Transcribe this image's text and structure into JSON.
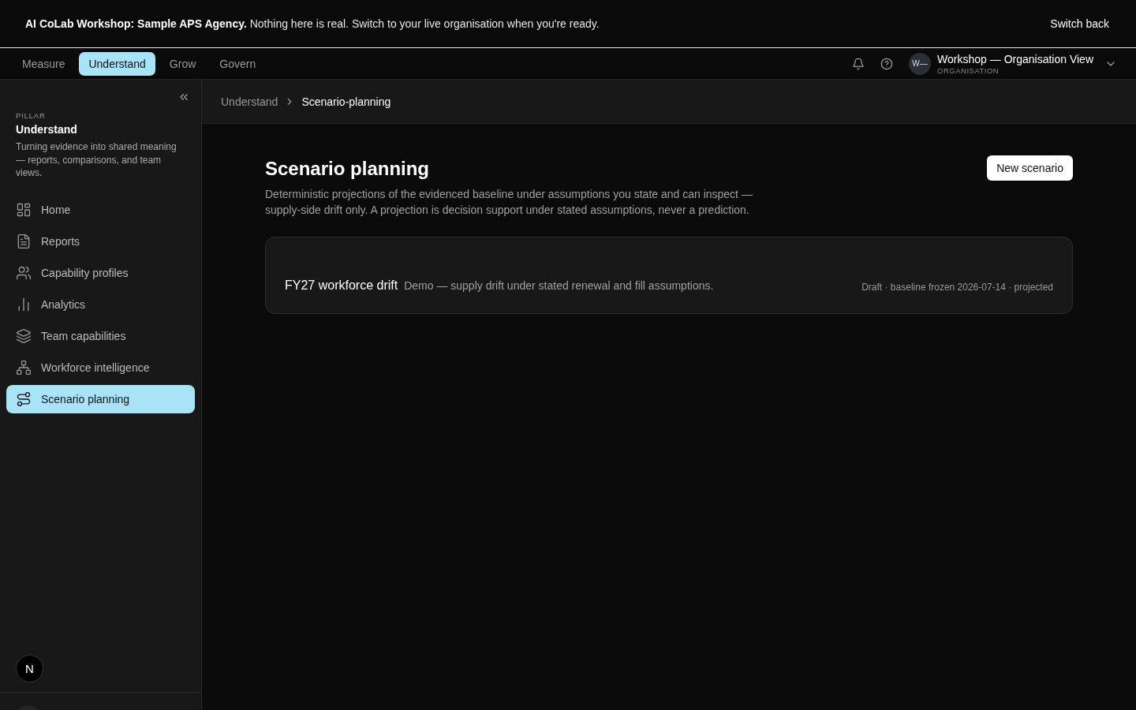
{
  "banner": {
    "message": "**AI CoLab Workshop: Sample APS Agency.** Nothing here is real. Switch to your live organisation when you're ready.",
    "action": "Switch back"
  },
  "tabs": [
    {
      "label": "Measure",
      "selected": false
    },
    {
      "label": "Understand",
      "selected": true
    },
    {
      "label": "Grow",
      "selected": false
    },
    {
      "label": "Govern",
      "selected": false
    }
  ],
  "account": {
    "avatar": "W—",
    "name": "Workshop — Organisation View",
    "role": "ORGANISATION"
  },
  "sidebar": {
    "eyebrow": "PILLAR",
    "title": "Understand",
    "description": "Turning evidence into shared meaning — reports, comparisons, and team views.",
    "items": [
      {
        "label": "Home",
        "selected": false
      },
      {
        "label": "Reports",
        "selected": false
      },
      {
        "label": "Capability profiles",
        "selected": false
      },
      {
        "label": "Analytics",
        "selected": false
      },
      {
        "label": "Team capabilities",
        "selected": false
      },
      {
        "label": "Workforce intelligence",
        "selected": false
      },
      {
        "label": "Scenario planning",
        "selected": true
      }
    ],
    "badge": "N"
  },
  "breadcrumb": [
    "Understand",
    "Scenario-planning"
  ],
  "page": {
    "title": "Scenario planning",
    "description": "Deterministic projections of the evidenced baseline under assumptions you state and can inspect — supply-side drift only. A projection is decision support under stated assumptions, never a prediction.",
    "action": "New scenario"
  },
  "scenarios": [
    {
      "name": "FY27 workforce drift",
      "summary": "Demo — supply drift under stated renewal and fill assumptions.",
      "meta": "Draft · baseline frozen 2026-07-14 · projected"
    }
  ]
}
